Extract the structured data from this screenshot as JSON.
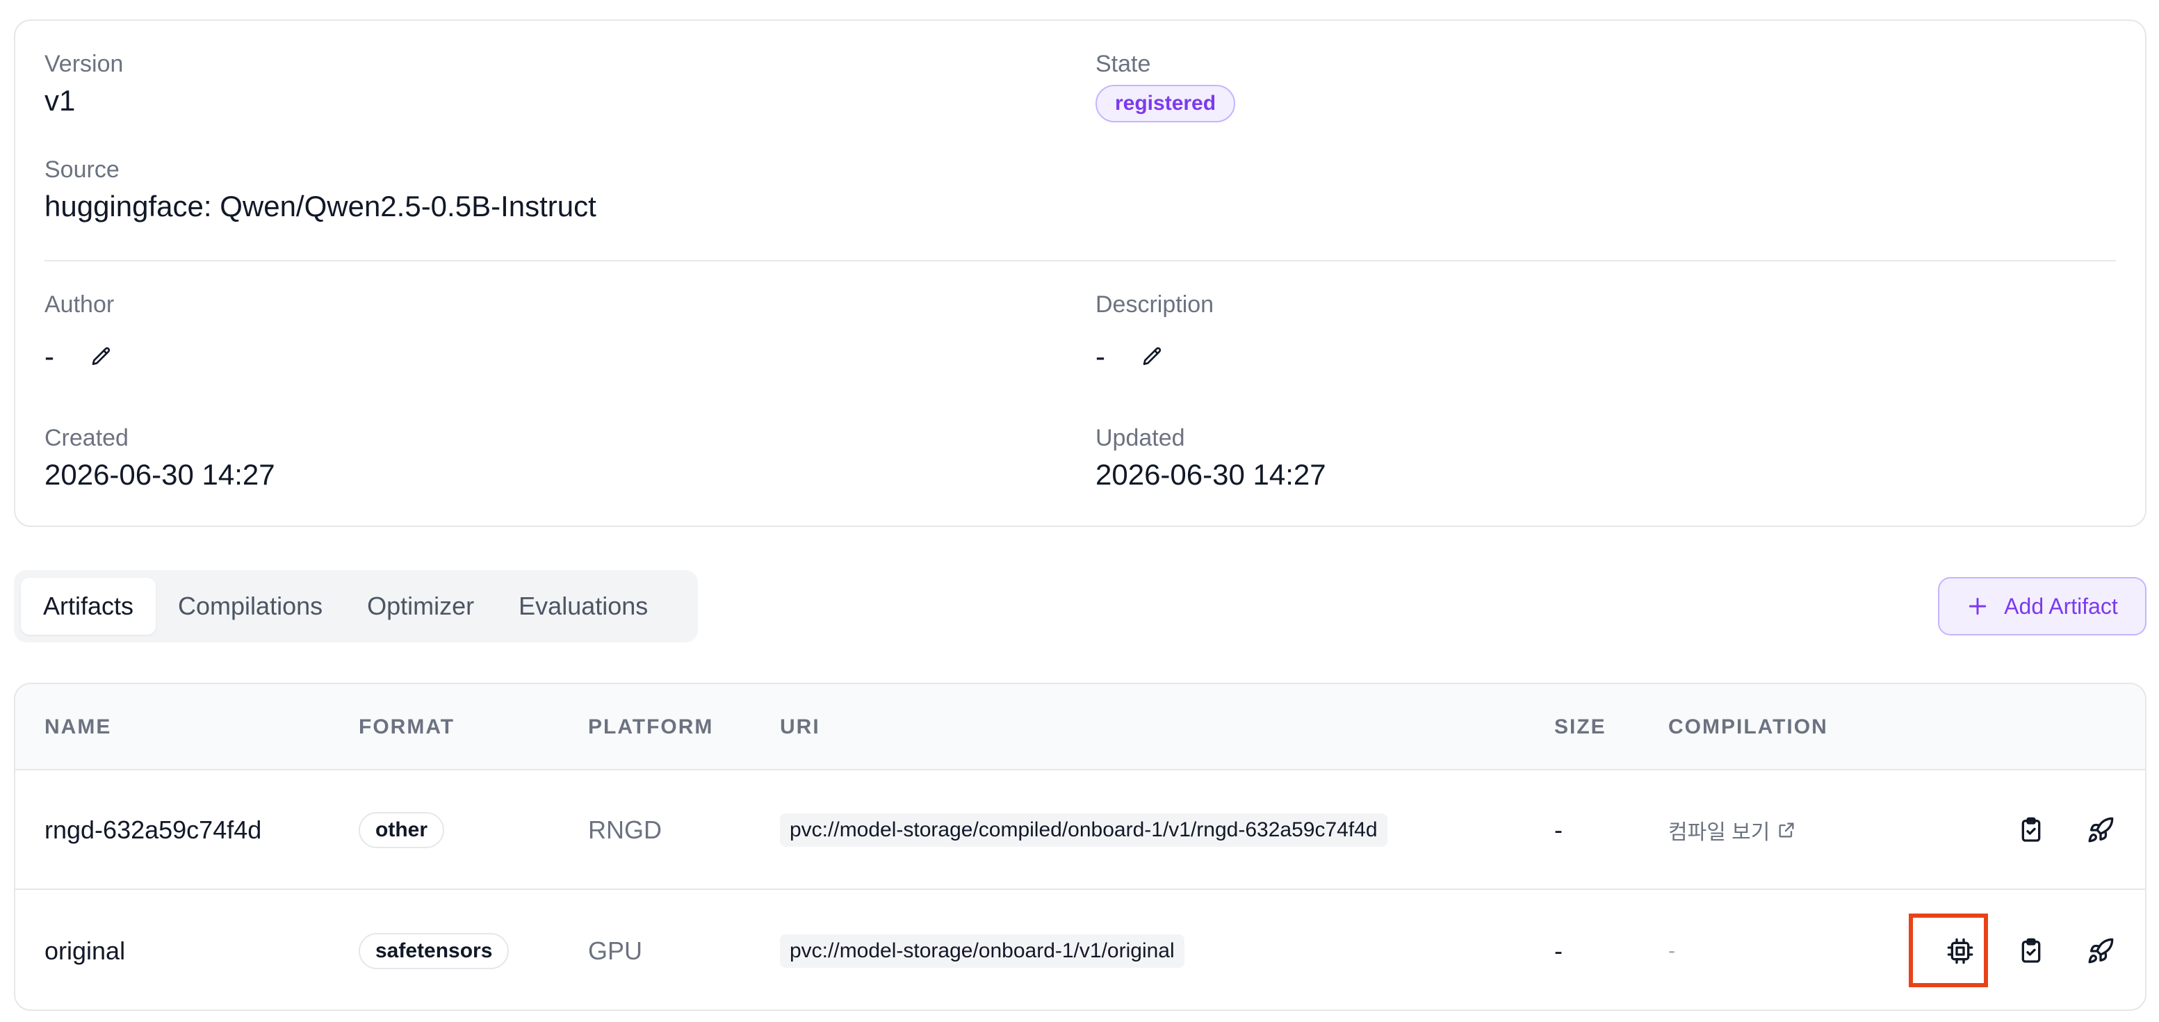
{
  "details": {
    "version_label": "Version",
    "version_value": "v1",
    "state_label": "State",
    "state_value": "registered",
    "source_label": "Source",
    "source_value": "huggingface: Qwen/Qwen2.5-0.5B-Instruct",
    "author_label": "Author",
    "author_value": "-",
    "description_label": "Description",
    "description_value": "-",
    "created_label": "Created",
    "created_value": "2026-06-30 14:27",
    "updated_label": "Updated",
    "updated_value": "2026-06-30 14:27"
  },
  "tabs": [
    {
      "label": "Artifacts",
      "active": true
    },
    {
      "label": "Compilations",
      "active": false
    },
    {
      "label": "Optimizer",
      "active": false
    },
    {
      "label": "Evaluations",
      "active": false
    }
  ],
  "add_artifact_label": "Add Artifact",
  "table": {
    "headers": [
      "NAME",
      "FORMAT",
      "PLATFORM",
      "URI",
      "SIZE",
      "COMPILATION"
    ],
    "rows": [
      {
        "name": "rngd-632a59c74f4d",
        "format": "other",
        "platform": "RNGD",
        "uri": "pvc://model-storage/compiled/onboard-1/v1/rngd-632a59c74f4d",
        "size": "-",
        "compilation": "컴파일 보기"
      },
      {
        "name": "original",
        "format": "safetensors",
        "platform": "GPU",
        "uri": "pvc://model-storage/onboard-1/v1/original",
        "size": "-",
        "compilation": "-"
      }
    ]
  },
  "icons": {
    "edit": "pencil-icon",
    "add": "plus-icon",
    "external": "external-link-icon",
    "compile": "chip-icon",
    "evaluate": "clipboard-check-icon",
    "deploy": "rocket-icon"
  },
  "colors": {
    "accent": "#7c3aed",
    "accent_bg": "#f3efff",
    "highlight": "#e8421a"
  }
}
